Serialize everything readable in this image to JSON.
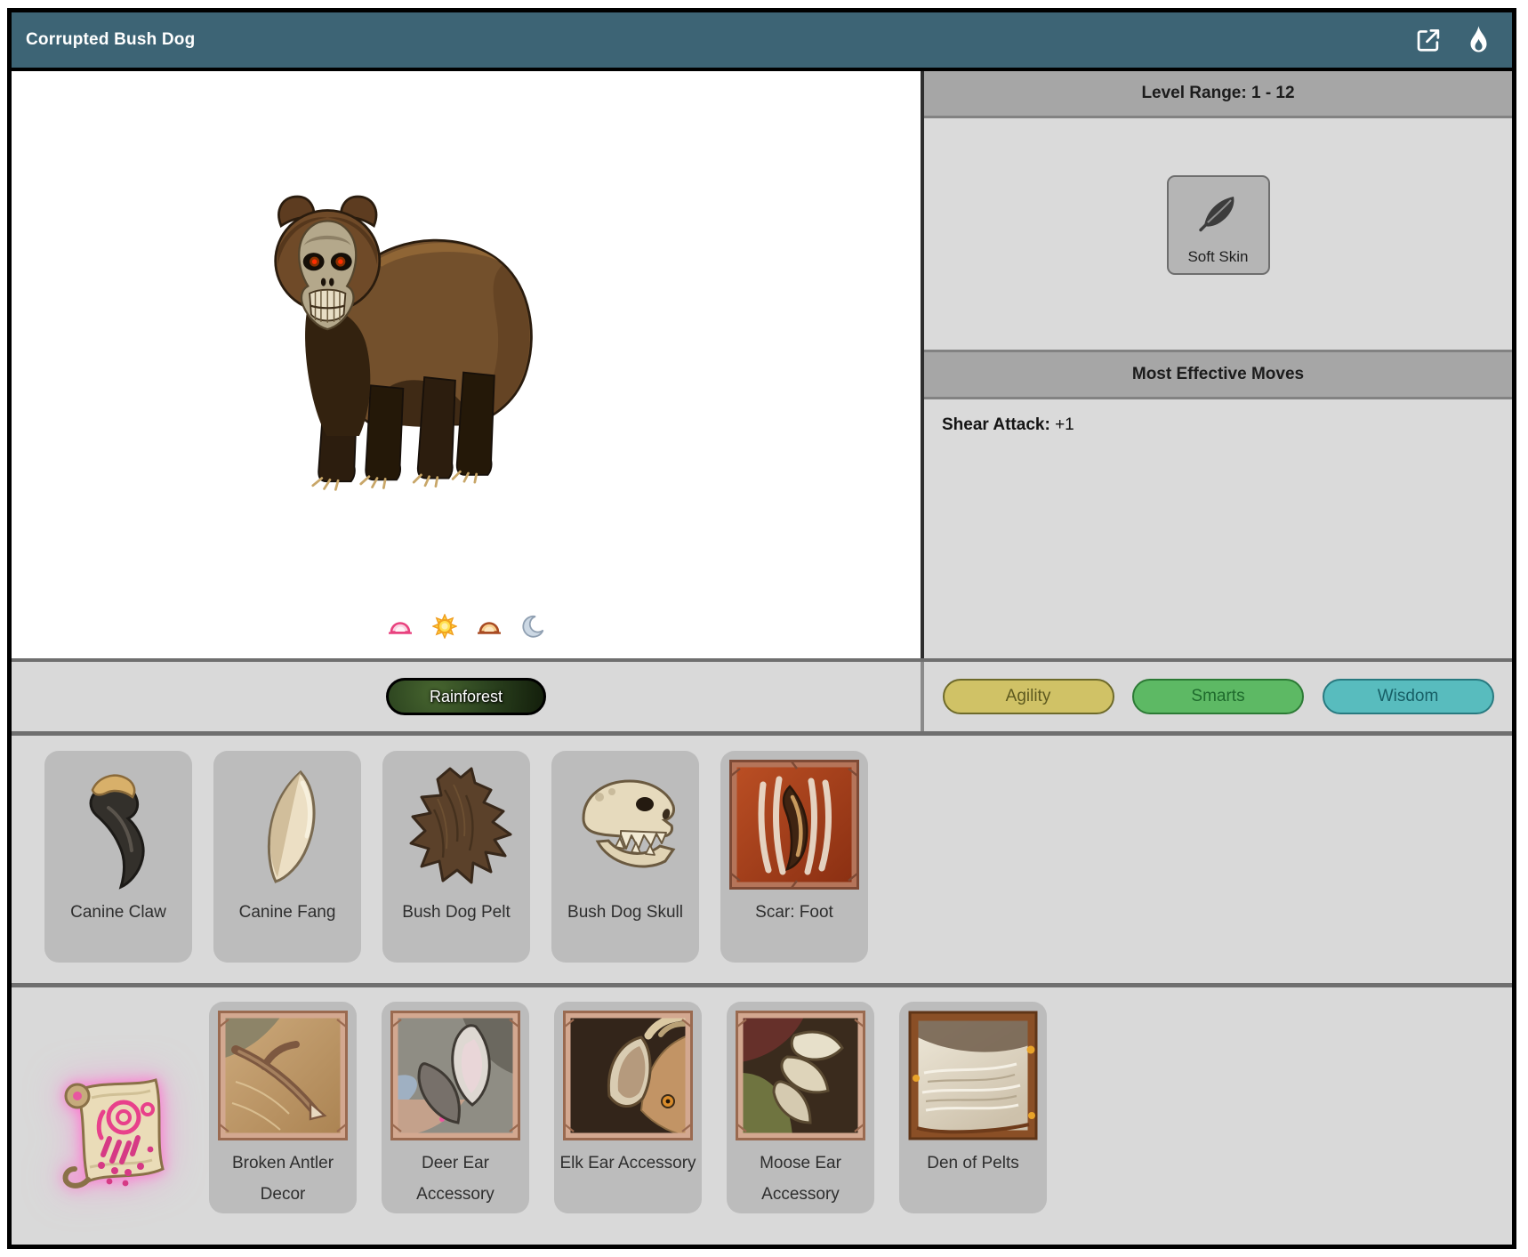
{
  "header": {
    "title": "Corrupted Bush Dog",
    "icons": [
      "open-external-icon",
      "flame-icon"
    ]
  },
  "creature_panel": {
    "time_of_day_icons": [
      "dawn",
      "day",
      "dusk",
      "night"
    ]
  },
  "stats_panel": {
    "level_range": "Level Range: 1 - 12",
    "trait": {
      "label": "Soft Skin",
      "icon": "feather-icon"
    },
    "moves_header": "Most Effective Moves",
    "moves": [
      {
        "name": "Shear Attack:",
        "value": "+1"
      }
    ]
  },
  "habitat": {
    "label": "Rainforest"
  },
  "stat_pills": [
    {
      "label": "Agility",
      "bg": "#d0c266",
      "border": "#6e6a2a",
      "text": "#5e5a1f"
    },
    {
      "label": "Smarts",
      "bg": "#5db964",
      "border": "#2c7a35",
      "text": "#1f6b2d"
    },
    {
      "label": "Wisdom",
      "bg": "#58bcbe",
      "border": "#287a80",
      "text": "#175f66"
    }
  ],
  "drops": [
    {
      "label": "Canine Claw",
      "icon": "canine-claw"
    },
    {
      "label": "Canine Fang",
      "icon": "canine-fang"
    },
    {
      "label": "Bush Dog Pelt",
      "icon": "bush-dog-pelt"
    },
    {
      "label": "Bush Dog Skull",
      "icon": "bush-dog-skull"
    },
    {
      "label": "Scar: Foot",
      "icon": "scar-foot"
    }
  ],
  "unlocks": {
    "scroll_icon": "rune-scroll-icon",
    "items": [
      {
        "label": "Broken Antler Decor",
        "icon": "broken-antler-decor"
      },
      {
        "label": "Deer Ear Accessory",
        "icon": "deer-ear-accessory"
      },
      {
        "label": "Elk Ear Accessory",
        "icon": "elk-ear-accessory"
      },
      {
        "label": "Moose Ear Accessory",
        "icon": "moose-ear-accessory"
      },
      {
        "label": "Den of Pelts",
        "icon": "den-of-pelts"
      }
    ]
  },
  "colors": {
    "titlebar_bg": "#3d6475",
    "section_header_bg": "#a6a6a6",
    "panel_body_bg": "#dadada",
    "section_bg": "#d9d9d9",
    "card_bg": "#bcbcbc",
    "eye_glow": "#ff2d00"
  }
}
